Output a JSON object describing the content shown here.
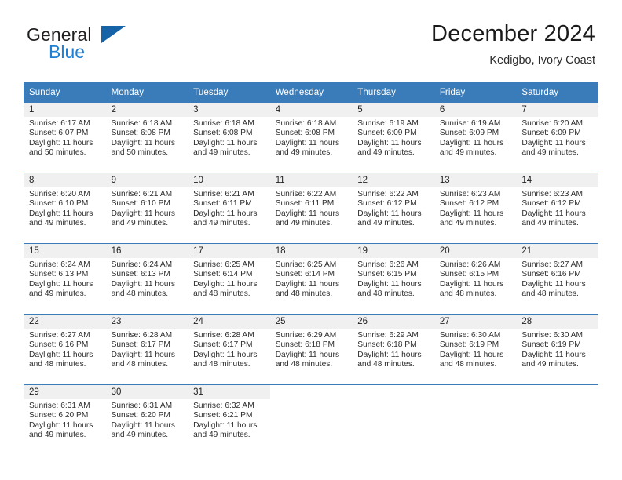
{
  "brand": {
    "name_top": "General",
    "name_bottom": "Blue",
    "logo_icon": "triangle-logo-icon"
  },
  "header": {
    "title": "December 2024",
    "subtitle": "Kedigbo, Ivory Coast"
  },
  "calendar": {
    "weekday_headers": [
      "Sunday",
      "Monday",
      "Tuesday",
      "Wednesday",
      "Thursday",
      "Friday",
      "Saturday"
    ],
    "accent_color": "#3a7cba",
    "daynum_band_color": "#f0f0f0",
    "weeks": [
      [
        {
          "day": "1",
          "sunrise": "Sunrise: 6:17 AM",
          "sunset": "Sunset: 6:07 PM",
          "daylight_1": "Daylight: 11 hours",
          "daylight_2": "and 50 minutes."
        },
        {
          "day": "2",
          "sunrise": "Sunrise: 6:18 AM",
          "sunset": "Sunset: 6:08 PM",
          "daylight_1": "Daylight: 11 hours",
          "daylight_2": "and 50 minutes."
        },
        {
          "day": "3",
          "sunrise": "Sunrise: 6:18 AM",
          "sunset": "Sunset: 6:08 PM",
          "daylight_1": "Daylight: 11 hours",
          "daylight_2": "and 49 minutes."
        },
        {
          "day": "4",
          "sunrise": "Sunrise: 6:18 AM",
          "sunset": "Sunset: 6:08 PM",
          "daylight_1": "Daylight: 11 hours",
          "daylight_2": "and 49 minutes."
        },
        {
          "day": "5",
          "sunrise": "Sunrise: 6:19 AM",
          "sunset": "Sunset: 6:09 PM",
          "daylight_1": "Daylight: 11 hours",
          "daylight_2": "and 49 minutes."
        },
        {
          "day": "6",
          "sunrise": "Sunrise: 6:19 AM",
          "sunset": "Sunset: 6:09 PM",
          "daylight_1": "Daylight: 11 hours",
          "daylight_2": "and 49 minutes."
        },
        {
          "day": "7",
          "sunrise": "Sunrise: 6:20 AM",
          "sunset": "Sunset: 6:09 PM",
          "daylight_1": "Daylight: 11 hours",
          "daylight_2": "and 49 minutes."
        }
      ],
      [
        {
          "day": "8",
          "sunrise": "Sunrise: 6:20 AM",
          "sunset": "Sunset: 6:10 PM",
          "daylight_1": "Daylight: 11 hours",
          "daylight_2": "and 49 minutes."
        },
        {
          "day": "9",
          "sunrise": "Sunrise: 6:21 AM",
          "sunset": "Sunset: 6:10 PM",
          "daylight_1": "Daylight: 11 hours",
          "daylight_2": "and 49 minutes."
        },
        {
          "day": "10",
          "sunrise": "Sunrise: 6:21 AM",
          "sunset": "Sunset: 6:11 PM",
          "daylight_1": "Daylight: 11 hours",
          "daylight_2": "and 49 minutes."
        },
        {
          "day": "11",
          "sunrise": "Sunrise: 6:22 AM",
          "sunset": "Sunset: 6:11 PM",
          "daylight_1": "Daylight: 11 hours",
          "daylight_2": "and 49 minutes."
        },
        {
          "day": "12",
          "sunrise": "Sunrise: 6:22 AM",
          "sunset": "Sunset: 6:12 PM",
          "daylight_1": "Daylight: 11 hours",
          "daylight_2": "and 49 minutes."
        },
        {
          "day": "13",
          "sunrise": "Sunrise: 6:23 AM",
          "sunset": "Sunset: 6:12 PM",
          "daylight_1": "Daylight: 11 hours",
          "daylight_2": "and 49 minutes."
        },
        {
          "day": "14",
          "sunrise": "Sunrise: 6:23 AM",
          "sunset": "Sunset: 6:12 PM",
          "daylight_1": "Daylight: 11 hours",
          "daylight_2": "and 49 minutes."
        }
      ],
      [
        {
          "day": "15",
          "sunrise": "Sunrise: 6:24 AM",
          "sunset": "Sunset: 6:13 PM",
          "daylight_1": "Daylight: 11 hours",
          "daylight_2": "and 49 minutes."
        },
        {
          "day": "16",
          "sunrise": "Sunrise: 6:24 AM",
          "sunset": "Sunset: 6:13 PM",
          "daylight_1": "Daylight: 11 hours",
          "daylight_2": "and 48 minutes."
        },
        {
          "day": "17",
          "sunrise": "Sunrise: 6:25 AM",
          "sunset": "Sunset: 6:14 PM",
          "daylight_1": "Daylight: 11 hours",
          "daylight_2": "and 48 minutes."
        },
        {
          "day": "18",
          "sunrise": "Sunrise: 6:25 AM",
          "sunset": "Sunset: 6:14 PM",
          "daylight_1": "Daylight: 11 hours",
          "daylight_2": "and 48 minutes."
        },
        {
          "day": "19",
          "sunrise": "Sunrise: 6:26 AM",
          "sunset": "Sunset: 6:15 PM",
          "daylight_1": "Daylight: 11 hours",
          "daylight_2": "and 48 minutes."
        },
        {
          "day": "20",
          "sunrise": "Sunrise: 6:26 AM",
          "sunset": "Sunset: 6:15 PM",
          "daylight_1": "Daylight: 11 hours",
          "daylight_2": "and 48 minutes."
        },
        {
          "day": "21",
          "sunrise": "Sunrise: 6:27 AM",
          "sunset": "Sunset: 6:16 PM",
          "daylight_1": "Daylight: 11 hours",
          "daylight_2": "and 48 minutes."
        }
      ],
      [
        {
          "day": "22",
          "sunrise": "Sunrise: 6:27 AM",
          "sunset": "Sunset: 6:16 PM",
          "daylight_1": "Daylight: 11 hours",
          "daylight_2": "and 48 minutes."
        },
        {
          "day": "23",
          "sunrise": "Sunrise: 6:28 AM",
          "sunset": "Sunset: 6:17 PM",
          "daylight_1": "Daylight: 11 hours",
          "daylight_2": "and 48 minutes."
        },
        {
          "day": "24",
          "sunrise": "Sunrise: 6:28 AM",
          "sunset": "Sunset: 6:17 PM",
          "daylight_1": "Daylight: 11 hours",
          "daylight_2": "and 48 minutes."
        },
        {
          "day": "25",
          "sunrise": "Sunrise: 6:29 AM",
          "sunset": "Sunset: 6:18 PM",
          "daylight_1": "Daylight: 11 hours",
          "daylight_2": "and 48 minutes."
        },
        {
          "day": "26",
          "sunrise": "Sunrise: 6:29 AM",
          "sunset": "Sunset: 6:18 PM",
          "daylight_1": "Daylight: 11 hours",
          "daylight_2": "and 48 minutes."
        },
        {
          "day": "27",
          "sunrise": "Sunrise: 6:30 AM",
          "sunset": "Sunset: 6:19 PM",
          "daylight_1": "Daylight: 11 hours",
          "daylight_2": "and 48 minutes."
        },
        {
          "day": "28",
          "sunrise": "Sunrise: 6:30 AM",
          "sunset": "Sunset: 6:19 PM",
          "daylight_1": "Daylight: 11 hours",
          "daylight_2": "and 49 minutes."
        }
      ],
      [
        {
          "day": "29",
          "sunrise": "Sunrise: 6:31 AM",
          "sunset": "Sunset: 6:20 PM",
          "daylight_1": "Daylight: 11 hours",
          "daylight_2": "and 49 minutes."
        },
        {
          "day": "30",
          "sunrise": "Sunrise: 6:31 AM",
          "sunset": "Sunset: 6:20 PM",
          "daylight_1": "Daylight: 11 hours",
          "daylight_2": "and 49 minutes."
        },
        {
          "day": "31",
          "sunrise": "Sunrise: 6:32 AM",
          "sunset": "Sunset: 6:21 PM",
          "daylight_1": "Daylight: 11 hours",
          "daylight_2": "and 49 minutes."
        },
        {
          "day": "",
          "sunrise": "",
          "sunset": "",
          "daylight_1": "",
          "daylight_2": ""
        },
        {
          "day": "",
          "sunrise": "",
          "sunset": "",
          "daylight_1": "",
          "daylight_2": ""
        },
        {
          "day": "",
          "sunrise": "",
          "sunset": "",
          "daylight_1": "",
          "daylight_2": ""
        },
        {
          "day": "",
          "sunrise": "",
          "sunset": "",
          "daylight_1": "",
          "daylight_2": ""
        }
      ]
    ]
  }
}
